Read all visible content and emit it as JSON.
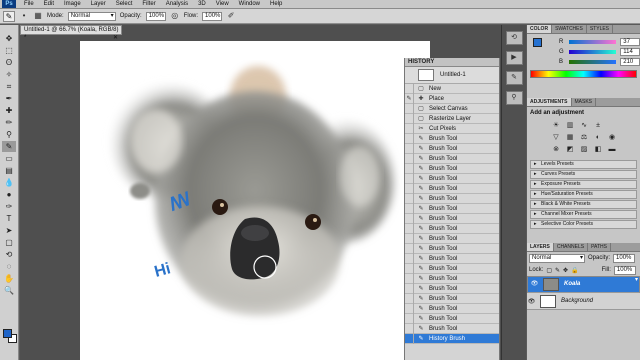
{
  "menu": {
    "logo": "Ps",
    "items": [
      "File",
      "Edit",
      "Image",
      "Layer",
      "Select",
      "Filter",
      "Analysis",
      "3D",
      "View",
      "Window",
      "Help"
    ]
  },
  "options": {
    "mode_label": "Mode:",
    "mode_value": "Normal",
    "opacity_label": "Opacity:",
    "opacity_value": "100%",
    "flow_label": "Flow:",
    "flow_value": "100%"
  },
  "document": {
    "tab_title": "Untitled-1 @ 66.7% (Koala, RGB/8) *"
  },
  "history": {
    "title": "HISTORY",
    "snapshot_label": "Untitled-1",
    "steps": [
      "New",
      "Place",
      "Select Canvas",
      "Rasterize Layer",
      "Cut Pixels",
      "Brush Tool",
      "Brush Tool",
      "Brush Tool",
      "Brush Tool",
      "Brush Tool",
      "Brush Tool",
      "Brush Tool",
      "Brush Tool",
      "Brush Tool",
      "Brush Tool",
      "Brush Tool",
      "Brush Tool",
      "Brush Tool",
      "Brush Tool",
      "Brush Tool",
      "Brush Tool",
      "Brush Tool",
      "Brush Tool",
      "Brush Tool",
      "Brush Tool",
      "History Brush"
    ],
    "active_index": 25
  },
  "color_panel": {
    "tabs": [
      "COLOR",
      "SWATCHES",
      "STYLES"
    ],
    "channels": [
      {
        "name": "R",
        "value": "37"
      },
      {
        "name": "G",
        "value": "114"
      },
      {
        "name": "B",
        "value": "210"
      }
    ],
    "foreground_color": "#2572d2"
  },
  "adjustments": {
    "tabs": [
      "ADJUSTMENTS",
      "MASKS"
    ],
    "heading": "Add an adjustment",
    "presets": [
      "Levels Presets",
      "Curves Presets",
      "Exposure Presets",
      "Hue/Saturation Presets",
      "Black & White Presets",
      "Channel Mixer Presets",
      "Selective Color Presets"
    ]
  },
  "layers": {
    "tabs": [
      "LAYERS",
      "CHANNELS",
      "PATHS"
    ],
    "blend_mode": "Normal",
    "opacity_label": "Opacity:",
    "opacity_value": "100%",
    "lock_label": "Lock:",
    "fill_label": "Fill:",
    "fill_value": "100%",
    "items": [
      {
        "name": "Koala",
        "selected": true
      },
      {
        "name": "Background",
        "selected": false
      }
    ]
  },
  "canvas": {
    "brush_strokes": [
      "ꟿ",
      "Hi"
    ]
  }
}
